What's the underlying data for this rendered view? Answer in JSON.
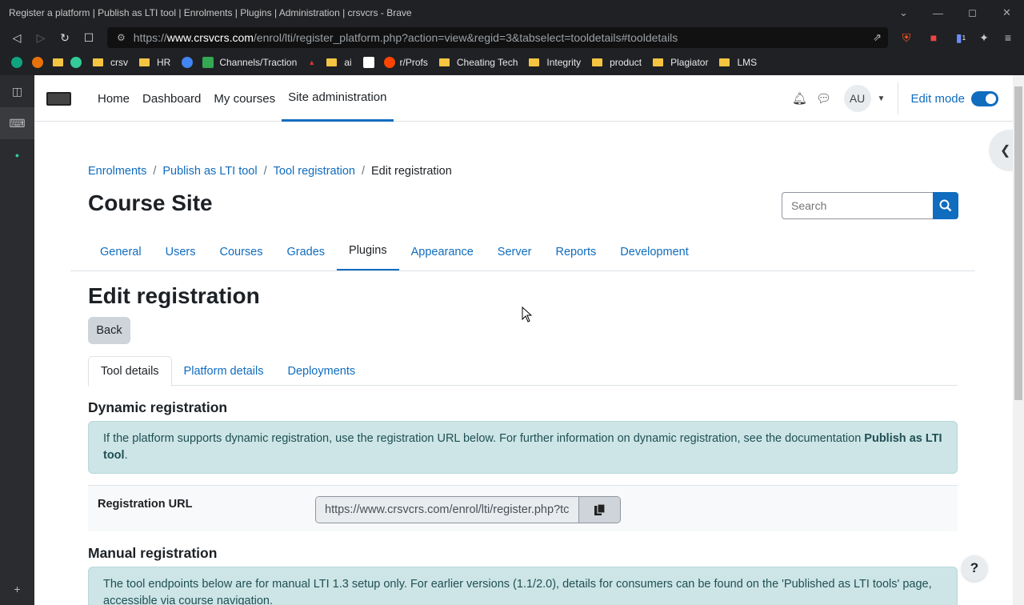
{
  "window": {
    "title": "Register a platform | Publish as LTI tool | Enrolments | Plugins | Administration | crsvcrs - Brave"
  },
  "browser": {
    "url_prefix": "https://",
    "url_host": "www.crsvcrs.com",
    "url_path": "/enrol/lti/register_platform.php?action=view&regid=3&tabselect=tooldetails#tooldetails",
    "extension_badge": "1"
  },
  "bookmarks": [
    {
      "label": "crsv"
    },
    {
      "label": "HR"
    },
    {
      "label": "Channels/Traction"
    },
    {
      "label": "ai"
    },
    {
      "label": "r/Profs"
    },
    {
      "label": "Cheating Tech"
    },
    {
      "label": "Integrity"
    },
    {
      "label": "product"
    },
    {
      "label": "Plagiator"
    },
    {
      "label": "LMS"
    }
  ],
  "topnav": {
    "items": [
      "Home",
      "Dashboard",
      "My courses",
      "Site administration"
    ],
    "avatar_initials": "AU",
    "edit_mode_label": "Edit mode"
  },
  "breadcrumb": [
    "Enrolments",
    "Publish as LTI tool",
    "Tool registration",
    "Edit registration"
  ],
  "site_title": "Course Site",
  "search": {
    "placeholder": "Search"
  },
  "secondary_nav": [
    "General",
    "Users",
    "Courses",
    "Grades",
    "Plugins",
    "Appearance",
    "Server",
    "Reports",
    "Development"
  ],
  "page_heading": "Edit registration",
  "back_label": "Back",
  "tabs": [
    "Tool details",
    "Platform details",
    "Deployments"
  ],
  "dynamic": {
    "heading": "Dynamic registration",
    "info_text": "If the platform supports dynamic registration, use the registration URL below. For further information on dynamic registration, see the documentation ",
    "info_link": "Publish as LTI tool",
    "info_end": ".",
    "url_label": "Registration URL",
    "url_value": "https://www.crsvcrs.com/enrol/lti/register.php?tc"
  },
  "manual": {
    "heading": "Manual registration",
    "info_text": "The tool endpoints below are for manual LTI 1.3 setup only. For earlier versions (1.1/2.0), details for consumers can be found on the 'Published as LTI tools' page, accessible via course navigation."
  },
  "help_label": "?"
}
